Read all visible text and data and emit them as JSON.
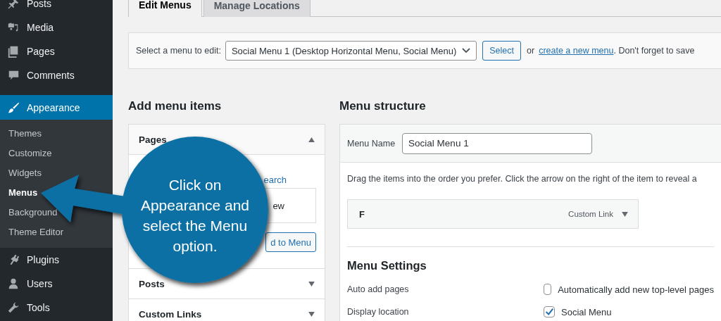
{
  "sidebar": {
    "items": [
      {
        "label": "Posts",
        "selected": false
      },
      {
        "label": "Media",
        "selected": false
      },
      {
        "label": "Pages",
        "selected": false
      },
      {
        "label": "Comments",
        "selected": false
      },
      {
        "label": "Appearance",
        "selected": true,
        "children": [
          {
            "label": "Themes",
            "selected": false
          },
          {
            "label": "Customize",
            "selected": false
          },
          {
            "label": "Widgets",
            "selected": false
          },
          {
            "label": "Menus",
            "selected": true
          },
          {
            "label": "Background",
            "selected": false
          },
          {
            "label": "Theme Editor",
            "selected": false
          }
        ]
      },
      {
        "label": "Plugins",
        "selected": false
      },
      {
        "label": "Users",
        "selected": false
      },
      {
        "label": "Tools",
        "selected": false
      }
    ]
  },
  "tabs": [
    {
      "label": "Edit Menus",
      "selected": true
    },
    {
      "label": "Manage Locations",
      "selected": false
    }
  ],
  "menu_select": {
    "label": "Select a menu to edit:",
    "value": "Social Menu 1 (Desktop Horizontal Menu, Social Menu)",
    "button": "Select",
    "text_before_link": "or",
    "link": "create a new menu",
    "text_after_link": ". Don't forget to save"
  },
  "add_menu_items": {
    "heading": "Add menu items",
    "sections": [
      {
        "title": "Pages",
        "expanded": true
      },
      {
        "title": "Posts",
        "expanded": false
      },
      {
        "title": "Custom Links",
        "expanded": false
      }
    ],
    "pages_panel": {
      "tab": "earch",
      "preview": "ew",
      "button": "d to Menu"
    }
  },
  "menu_structure": {
    "heading": "Menu structure",
    "name_label": "Menu Name",
    "name_value": "Social Menu 1",
    "instructions": "Drag the items into the order you prefer. Click the arrow on the right of the item to reveal a",
    "items": [
      {
        "title": "F",
        "type": "Custom Link"
      }
    ],
    "settings": {
      "heading": "Menu Settings",
      "rows": [
        {
          "label": "Auto add pages",
          "option": "Automatically add new top-level pages",
          "checked": false
        },
        {
          "label": "Display location",
          "option": "Social Menu",
          "checked": true
        }
      ]
    }
  },
  "callout": {
    "text": "Click on Appearance and select the Menu option."
  }
}
